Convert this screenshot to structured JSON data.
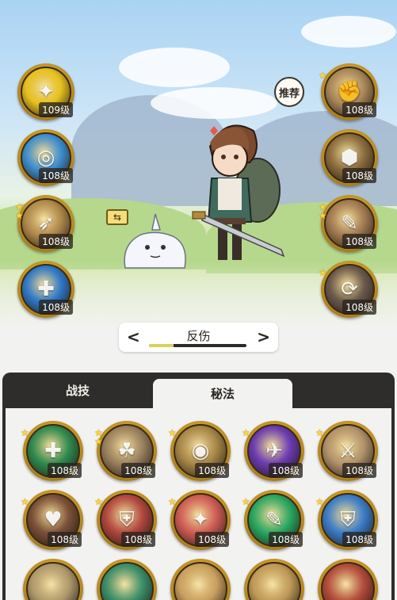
{
  "scene": {
    "recommend_label": "推荐",
    "swap_symbol": "⇆"
  },
  "left_skills": [
    {
      "level": "109级",
      "glyph": "✦",
      "bg": "#e7c21d",
      "stars": 0,
      "icon": "gold-crystal-icon"
    },
    {
      "level": "108级",
      "glyph": "◎",
      "bg": "#3e8fd0",
      "stars": 0,
      "icon": "blue-ring-icon"
    },
    {
      "level": "108级",
      "glyph": "➶",
      "bg": "#b08a4b",
      "stars": 2,
      "icon": "wind-slash-icon"
    },
    {
      "level": "108级",
      "glyph": "✚",
      "bg": "#2f79c9",
      "stars": 0,
      "icon": "blue-burst-icon"
    }
  ],
  "right_skills": [
    {
      "level": "108级",
      "glyph": "✊",
      "bg": "#a9875a",
      "stars": 1,
      "icon": "fist-icon"
    },
    {
      "level": "108级",
      "glyph": "⬢",
      "bg": "#8b6c3f",
      "stars": 0,
      "icon": "armor-icon"
    },
    {
      "level": "108级",
      "glyph": "✎",
      "bg": "#a27a52",
      "stars": 2,
      "icon": "blade-strike-icon"
    },
    {
      "level": "108级",
      "glyph": "⟳",
      "bg": "#6a5a4d",
      "stars": 1,
      "icon": "shield-spin-icon"
    }
  ],
  "selector": {
    "prev": "<",
    "next": ">",
    "name": "反伤",
    "progress": 0.25
  },
  "tabs": {
    "tab1": "战技",
    "tab2": "秘法"
  },
  "grid": [
    {
      "level": "108级",
      "glyph": "✚",
      "bg": "#2f8a4f",
      "stars": 1,
      "icon": "heal-cross-icon"
    },
    {
      "level": "108级",
      "glyph": "☘",
      "bg": "#9a8160",
      "stars": 2,
      "icon": "buff-group-icon"
    },
    {
      "level": "108级",
      "glyph": "◉",
      "bg": "#a88848",
      "stars": 1,
      "icon": "eye-icon"
    },
    {
      "level": "108级",
      "glyph": "✈",
      "bg": "#6b3bb3",
      "stars": 1,
      "icon": "purple-dash-icon"
    },
    {
      "level": "108级",
      "glyph": "⚔",
      "bg": "#b2936c",
      "stars": 1,
      "icon": "sword-up-icon"
    },
    {
      "level": "108级",
      "glyph": "♥",
      "bg": "#7a5038",
      "stars": 1,
      "icon": "heart-shield-icon"
    },
    {
      "level": "108级",
      "glyph": "⛨",
      "bg": "#b0473f",
      "stars": 1,
      "icon": "red-shield-icon"
    },
    {
      "level": "108级",
      "glyph": "✦",
      "bg": "#cf5c55",
      "stars": 1,
      "icon": "red-sword-icon"
    },
    {
      "level": "108级",
      "glyph": "✎",
      "bg": "#2aa863",
      "stars": 1,
      "icon": "green-blade-icon"
    },
    {
      "level": "108级",
      "glyph": "⛨",
      "bg": "#3b7dc9",
      "stars": 1,
      "icon": "blue-shield-icon"
    },
    {
      "level": "",
      "glyph": "",
      "bg": "#b09a6e",
      "stars": 0,
      "icon": "partial-icon"
    },
    {
      "level": "",
      "glyph": "",
      "bg": "#3a8f6a",
      "stars": 0,
      "icon": "partial-icon"
    },
    {
      "level": "",
      "glyph": "",
      "bg": "#c9a060",
      "stars": 0,
      "icon": "partial-icon"
    },
    {
      "level": "",
      "glyph": "",
      "bg": "#c09a58",
      "stars": 0,
      "icon": "partial-icon"
    },
    {
      "level": "",
      "glyph": "",
      "bg": "#b24a3a",
      "stars": 0,
      "icon": "partial-icon"
    }
  ]
}
